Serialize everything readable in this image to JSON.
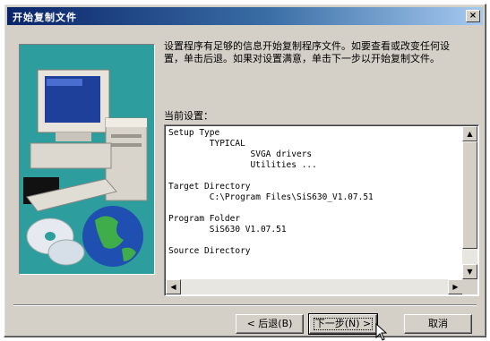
{
  "window": {
    "title": "开始复制文件",
    "close_label": "×"
  },
  "intro_text": "设置程序有足够的信息开始复制程序文件。如要查看或改变任何设置，单击后退。如果对设置满意，单击下一步以开始复制文件。",
  "section_label": "当前设置：",
  "settings_text": "Setup Type\n        TYPICAL\n                SVGA drivers\n                Utilities ...\n\nTarget Directory\n        C:\\Program Files\\SiS630_V1.07.51\n\nProgram Folder\n        SiS630 V1.07.51\n\nSource Directory",
  "buttons": {
    "back": "< 后退(B)",
    "next": "下一步(N) >",
    "cancel": "取消"
  },
  "scroll_glyphs": {
    "up": "▲",
    "down": "▼",
    "left": "◀",
    "right": "▶"
  }
}
